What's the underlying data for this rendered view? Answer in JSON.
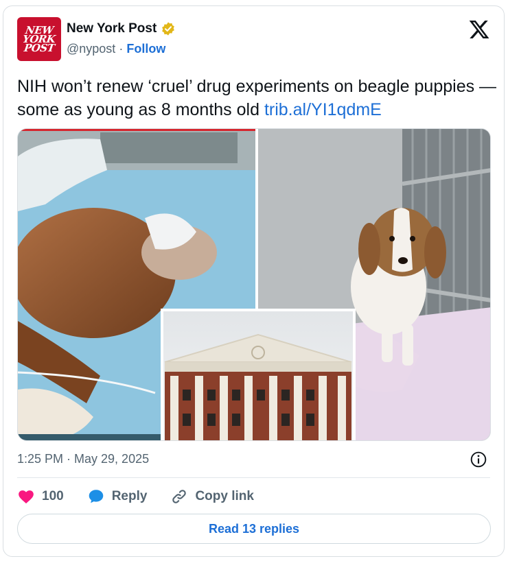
{
  "author": {
    "logo_lines": [
      "NEW",
      "YORK",
      "POST"
    ],
    "name": "New York Post",
    "handle": "@nypost",
    "separator": "·",
    "follow_label": "Follow",
    "verified_icon": "gold-verified-badge"
  },
  "tweet": {
    "text": "NIH won’t renew ‘cruel’ drug experiments on beagle puppies — some as young as 8 months old ",
    "link": "trib.al/YI1qdmE"
  },
  "media": {
    "images": [
      "sedated-dog-on-operating-table",
      "beagle-in-cage",
      "nih-building-facade"
    ]
  },
  "meta": {
    "timestamp": "1:25 PM · May 29, 2025"
  },
  "actions": {
    "like_count": "100",
    "reply_label": "Reply",
    "copy_link_label": "Copy link",
    "read_replies_label": "Read 13 replies"
  },
  "colors": {
    "accent_blue": "#1d6fd6",
    "brand_red": "#c8102e",
    "like_pink": "#f91880",
    "muted_text": "#536471",
    "verified_gold": "#e2b719"
  }
}
